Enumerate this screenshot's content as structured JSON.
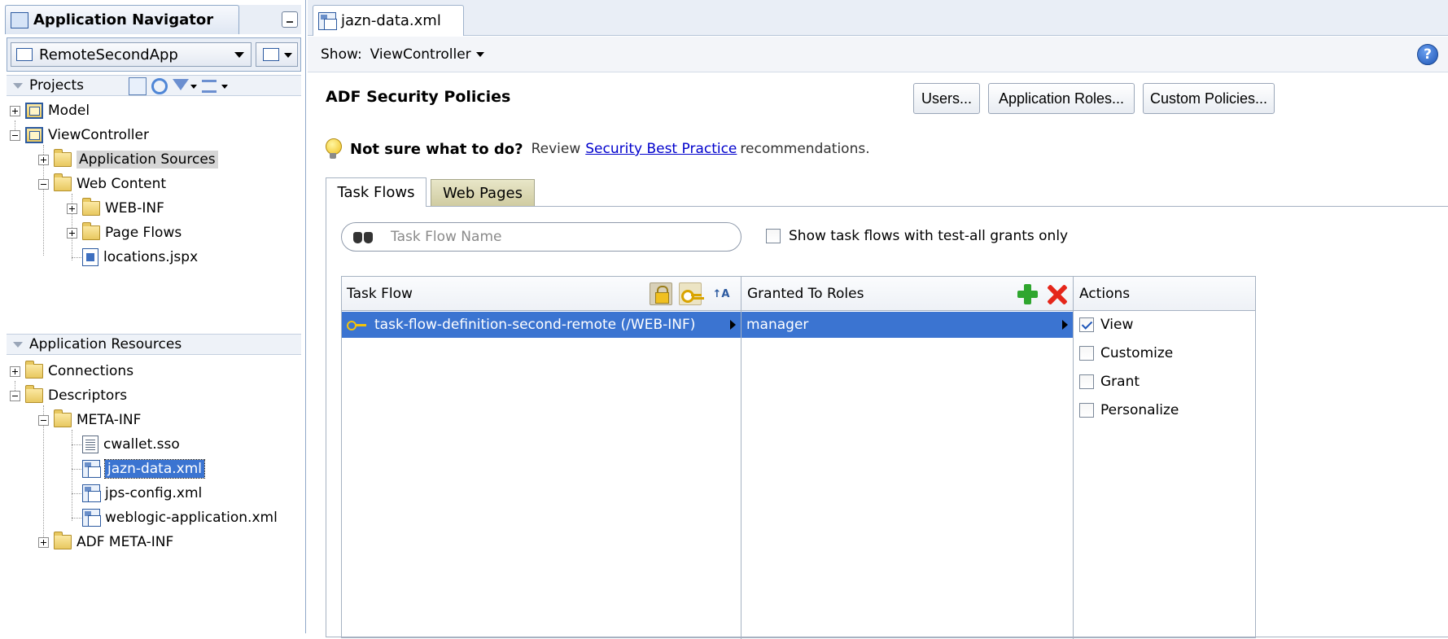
{
  "navigator": {
    "title": "Application Navigator",
    "app_name": "RemoteSecondApp",
    "projects_label": "Projects",
    "projects_tree": [
      {
        "label": "Model",
        "type": "project",
        "expander": "plus"
      },
      {
        "label": "ViewController",
        "type": "project",
        "expander": "minus"
      },
      {
        "label": "Application Sources",
        "type": "folder",
        "expander": "plus",
        "highlighted": true
      },
      {
        "label": "Web Content",
        "type": "folder",
        "expander": "minus"
      },
      {
        "label": "WEB-INF",
        "type": "folder",
        "expander": "plus"
      },
      {
        "label": "Page Flows",
        "type": "folder",
        "expander": "plus"
      },
      {
        "label": "locations.jspx",
        "type": "jspx"
      }
    ],
    "resources_label": "Application Resources",
    "resources_tree": [
      {
        "label": "Connections",
        "type": "folder",
        "expander": "plus"
      },
      {
        "label": "Descriptors",
        "type": "folder",
        "expander": "minus"
      },
      {
        "label": "META-INF",
        "type": "folder",
        "expander": "minus"
      },
      {
        "label": "cwallet.sso",
        "type": "file"
      },
      {
        "label": "jazn-data.xml",
        "type": "xml",
        "selected": true
      },
      {
        "label": "jps-config.xml",
        "type": "xml"
      },
      {
        "label": "weblogic-application.xml",
        "type": "xml"
      },
      {
        "label": "ADF META-INF",
        "type": "folder",
        "expander": "plus"
      }
    ]
  },
  "editor": {
    "tab_label": "jazn-data.xml",
    "show_label": "Show:",
    "show_value": "ViewController",
    "help_symbol": "?",
    "section_title": "ADF Security Policies",
    "buttons": {
      "users": "Users...",
      "app_roles": "Application Roles...",
      "custom_policies": "Custom Policies..."
    },
    "hint": {
      "lead": "Not sure what to do?",
      "review": "Review",
      "link": "Security Best Practice",
      "tail": "recommendations."
    },
    "tabs": {
      "task_flows": "Task Flows",
      "web_pages": "Web Pages"
    },
    "search_placeholder": "Task Flow Name",
    "filter_checkbox_label": "Show task flows with test-all grants only",
    "filter_checked": false,
    "table": {
      "col_task_flow": "Task Flow",
      "col_roles": "Granted To Roles",
      "col_actions": "Actions",
      "task_flow_row": "task-flow-definition-second-remote (/WEB-INF)",
      "role_row": "manager",
      "actions": [
        {
          "label": "View",
          "checked": true
        },
        {
          "label": "Customize",
          "checked": false
        },
        {
          "label": "Grant",
          "checked": false
        },
        {
          "label": "Personalize",
          "checked": false
        }
      ]
    }
  },
  "colors": {
    "selection": "#3b74d1",
    "link": "#0000cc",
    "add_green": "#2fa62f",
    "delete_red": "#e5261a"
  }
}
